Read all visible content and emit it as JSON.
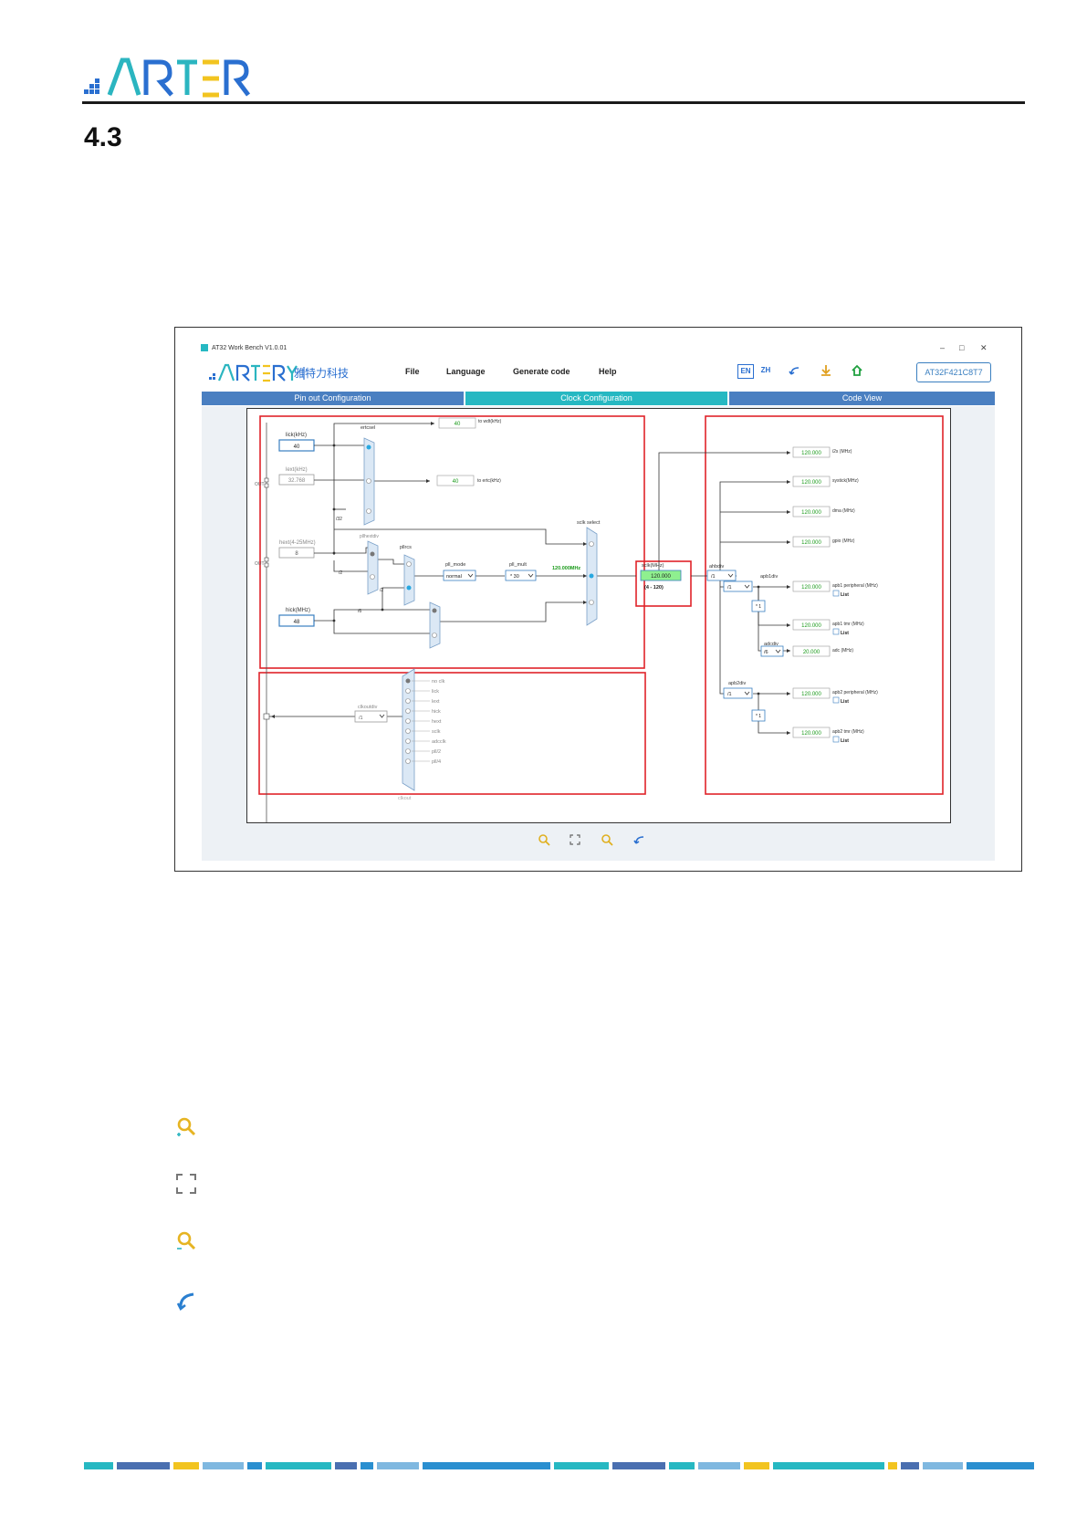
{
  "header": {
    "logo_text": "ARTERY",
    "section_number": "4.3"
  },
  "window": {
    "title": "AT32 Work Bench V1.0.01",
    "controls": [
      "–",
      "□",
      "✕"
    ],
    "logo_cn": "雅特力科技",
    "menu": [
      "File",
      "Language",
      "Generate code",
      "Help"
    ],
    "lang_en": "EN",
    "lang_zh": "ZH",
    "chip": "AT32F421C8T7",
    "tabs": [
      "Pin out Configuration",
      "Clock Configuration",
      "Code View"
    ]
  },
  "clock": {
    "lick_label": "lick(kHz)",
    "lick_val": "40",
    "lext_label": "lext(kHz)",
    "lext_val": "32.768",
    "hext_label": "hext(4-25MHz)",
    "hext_val": "8",
    "hick_label": "hick(MHz)",
    "hick_val": "48",
    "ertcsel": "ertcsel",
    "wdt_val": "40",
    "wdt_label": "to wdt(kHz)",
    "ertc_val": "40",
    "ertc_label": "to ertc(kHz)",
    "div32": "/32",
    "pllhextdiv": "pllhextdiv",
    "pllrcs": "pllrcs",
    "div2a": "/2",
    "div2b": "/2",
    "div6": "/6",
    "pll_mode_label": "pll_mode",
    "pll_mode_val": "normal",
    "pll_mult_label": "pll_mult",
    "pll_mult_val": "* 30",
    "pll_out": "120.000MHz",
    "sclk_select": "sclk select",
    "sclk_label": "sclk(MHz)",
    "sclk_val": "120.000",
    "sclk_range": "(4 - 120)",
    "ahbdiv": "ahbdiv",
    "ahbdiv_val": "/1",
    "apb1div": "apb1div",
    "apb1div_val": "/1",
    "apb2div": "apb2div",
    "apb2div_val": "/1",
    "adcdiv": "adcdiv",
    "adcdiv_val": "/6",
    "x1": "* 1",
    "list": "List",
    "outputs": [
      {
        "val": "120.000",
        "label": "i2s (MHz)"
      },
      {
        "val": "120.000",
        "label": "systick(MHz)"
      },
      {
        "val": "120.000",
        "label": "dma (MHz)"
      },
      {
        "val": "120.000",
        "label": "gpio (MHz)"
      },
      {
        "val": "120.000",
        "label": "apb1 peripheral (MHz)"
      },
      {
        "val": "120.000",
        "label": "apb1 tmr (MHz)"
      },
      {
        "val": "20.000",
        "label": "adc (MHz)"
      },
      {
        "val": "120.000",
        "label": "apb2 peripheral (MHz)"
      },
      {
        "val": "120.000",
        "label": "apb2 tmr (MHz)"
      }
    ],
    "clkout_div_label": "clkoutdiv",
    "clkout_div_val": "/1",
    "clkout_src": [
      "no clk",
      "lick",
      "lext",
      "hick",
      "hext",
      "sclk",
      "adcclk",
      "pll/2",
      "pll/4"
    ],
    "clkout_sel": "clkout",
    "out_label": "OUT"
  },
  "colors": {
    "tab_blue": "#4a7fc1",
    "tab_teal": "#26b8c2",
    "highlight": "#e0232a",
    "green_text": "#1a9a1a",
    "sclk_green": "#8ff08f"
  }
}
